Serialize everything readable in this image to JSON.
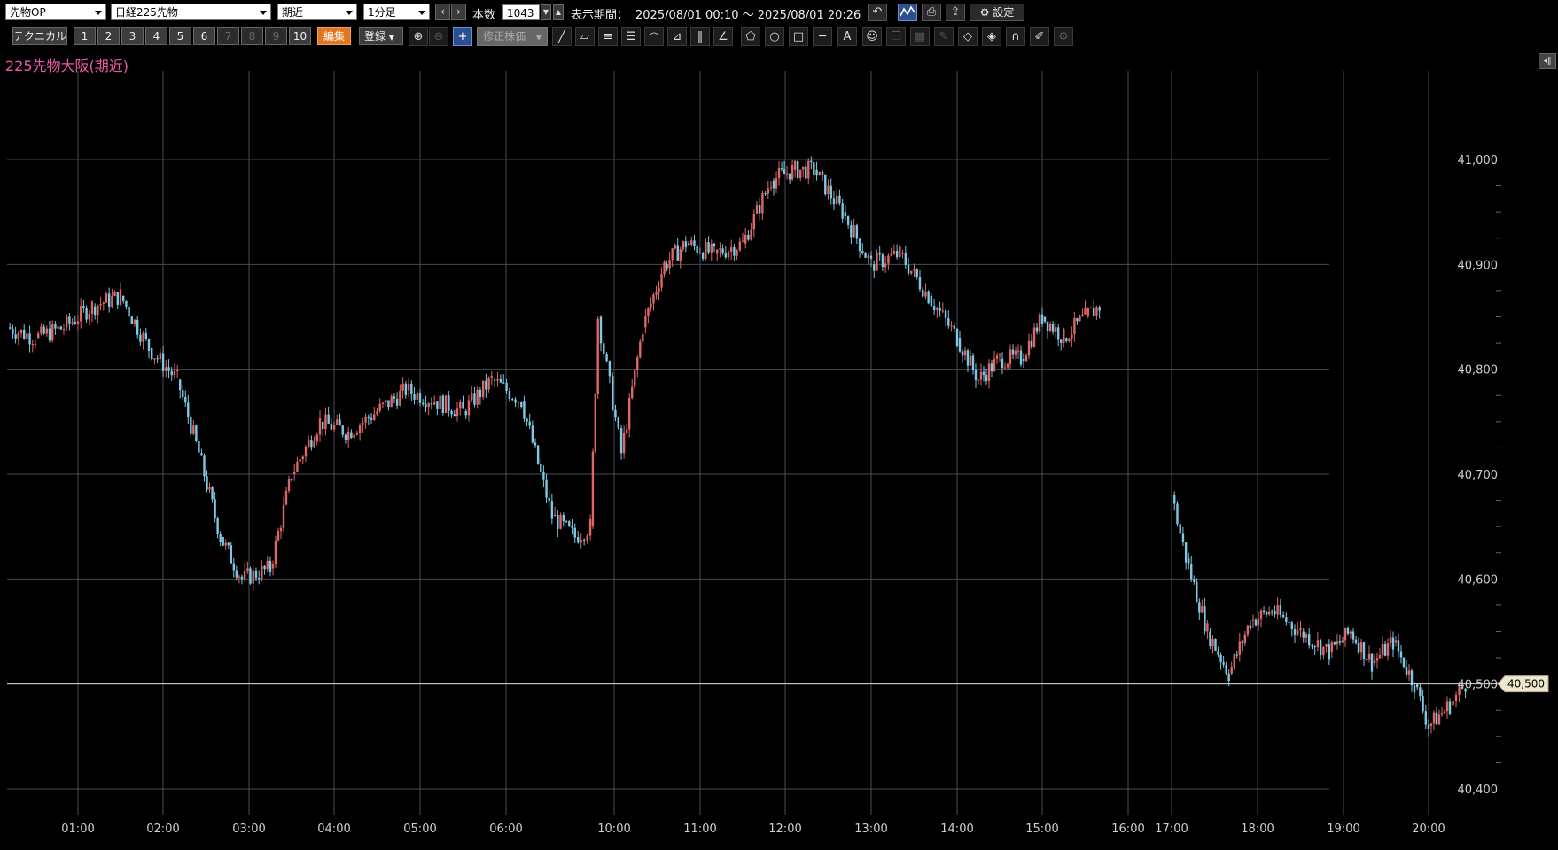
{
  "toolbar": {
    "market_select": "先物OP",
    "instrument_select": "日経225先物",
    "contract_select": "期近",
    "interval_select": "1分足",
    "prev_label": "‹",
    "next_label": "›",
    "count_label": "本数",
    "count_value": "1043",
    "period_label": "表示期間：",
    "period_value": "2025/08/01 00:10 ～ 2025/08/01 20:26",
    "settings_label": "設定"
  },
  "toolbar2": {
    "technical_label": "テクニカル",
    "slots": [
      "1",
      "2",
      "3",
      "4",
      "5",
      "6",
      "7",
      "8",
      "9",
      "10"
    ],
    "edit_label": "編集",
    "register_label": "登録",
    "adjusted_label": "修正株価"
  },
  "chart_title": "225先物大阪(期近)",
  "current_price_label": "40,500",
  "colors": {
    "up": "#e06666",
    "down": "#7ec8e3",
    "grid": "#4a4a5a",
    "title": "#e85aa8",
    "price_tag": "#f1e6cf"
  },
  "chart_data": {
    "type": "candlestick",
    "x_ticks": [
      "01:00",
      "02:00",
      "03:00",
      "04:00",
      "05:00",
      "06:00",
      "10:00",
      "11:00",
      "12:00",
      "13:00",
      "14:00",
      "15:00",
      "16:00",
      "17:00",
      "18:00",
      "19:00",
      "20:00"
    ],
    "y_ticks": [
      "41,000",
      "40,900",
      "40,800",
      "40,700",
      "40,600",
      "40,500",
      "40,400"
    ],
    "y_range": [
      40400,
      41000
    ],
    "current_price": 40500,
    "series": [
      {
        "x": "00:10",
        "y": 40840
      },
      {
        "x": "00:30",
        "y": 40830
      },
      {
        "x": "00:50",
        "y": 40840
      },
      {
        "x": "01:10",
        "y": 40860
      },
      {
        "x": "01:30",
        "y": 40870
      },
      {
        "x": "01:50",
        "y": 40820
      },
      {
        "x": "02:10",
        "y": 40790
      },
      {
        "x": "02:25",
        "y": 40720
      },
      {
        "x": "02:40",
        "y": 40640
      },
      {
        "x": "02:55",
        "y": 40600
      },
      {
        "x": "03:15",
        "y": 40610
      },
      {
        "x": "03:30",
        "y": 40700
      },
      {
        "x": "03:50",
        "y": 40750
      },
      {
        "x": "04:10",
        "y": 40740
      },
      {
        "x": "04:30",
        "y": 40760
      },
      {
        "x": "04:50",
        "y": 40780
      },
      {
        "x": "05:10",
        "y": 40770
      },
      {
        "x": "05:30",
        "y": 40760
      },
      {
        "x": "05:50",
        "y": 40790
      },
      {
        "x": "06:10",
        "y": 40770
      },
      {
        "x": "06:30",
        "y": 40660
      },
      {
        "x": "06:45",
        "y": 40640
      },
      {
        "x": "06:55",
        "y": 40650
      },
      {
        "x": "07:00",
        "y": 40850
      },
      {
        "x": "10:05",
        "y": 40720
      },
      {
        "x": "10:20",
        "y": 40840
      },
      {
        "x": "10:35",
        "y": 40900
      },
      {
        "x": "10:50",
        "y": 40920
      },
      {
        "x": "11:10",
        "y": 40910
      },
      {
        "x": "11:30",
        "y": 40920
      },
      {
        "x": "11:50",
        "y": 40980
      },
      {
        "x": "12:05",
        "y": 40990
      },
      {
        "x": "12:20",
        "y": 40990
      },
      {
        "x": "12:40",
        "y": 40950
      },
      {
        "x": "13:00",
        "y": 40900
      },
      {
        "x": "13:20",
        "y": 40910
      },
      {
        "x": "13:40",
        "y": 40870
      },
      {
        "x": "14:00",
        "y": 40830
      },
      {
        "x": "14:15",
        "y": 40790
      },
      {
        "x": "14:30",
        "y": 40810
      },
      {
        "x": "14:45",
        "y": 40810
      },
      {
        "x": "15:00",
        "y": 40850
      },
      {
        "x": "15:15",
        "y": 40830
      },
      {
        "x": "15:30",
        "y": 40850
      },
      {
        "x": "15:40",
        "y": 40860
      },
      {
        "x": "17:00",
        "y": 40680
      },
      {
        "x": "17:10",
        "y": 40620
      },
      {
        "x": "17:25",
        "y": 40550
      },
      {
        "x": "17:40",
        "y": 40510
      },
      {
        "x": "17:55",
        "y": 40560
      },
      {
        "x": "18:10",
        "y": 40570
      },
      {
        "x": "18:30",
        "y": 40550
      },
      {
        "x": "18:50",
        "y": 40530
      },
      {
        "x": "19:05",
        "y": 40550
      },
      {
        "x": "19:20",
        "y": 40520
      },
      {
        "x": "19:35",
        "y": 40540
      },
      {
        "x": "19:50",
        "y": 40500
      },
      {
        "x": "20:00",
        "y": 40460
      },
      {
        "x": "20:15",
        "y": 40480
      },
      {
        "x": "20:26",
        "y": 40500
      }
    ]
  }
}
